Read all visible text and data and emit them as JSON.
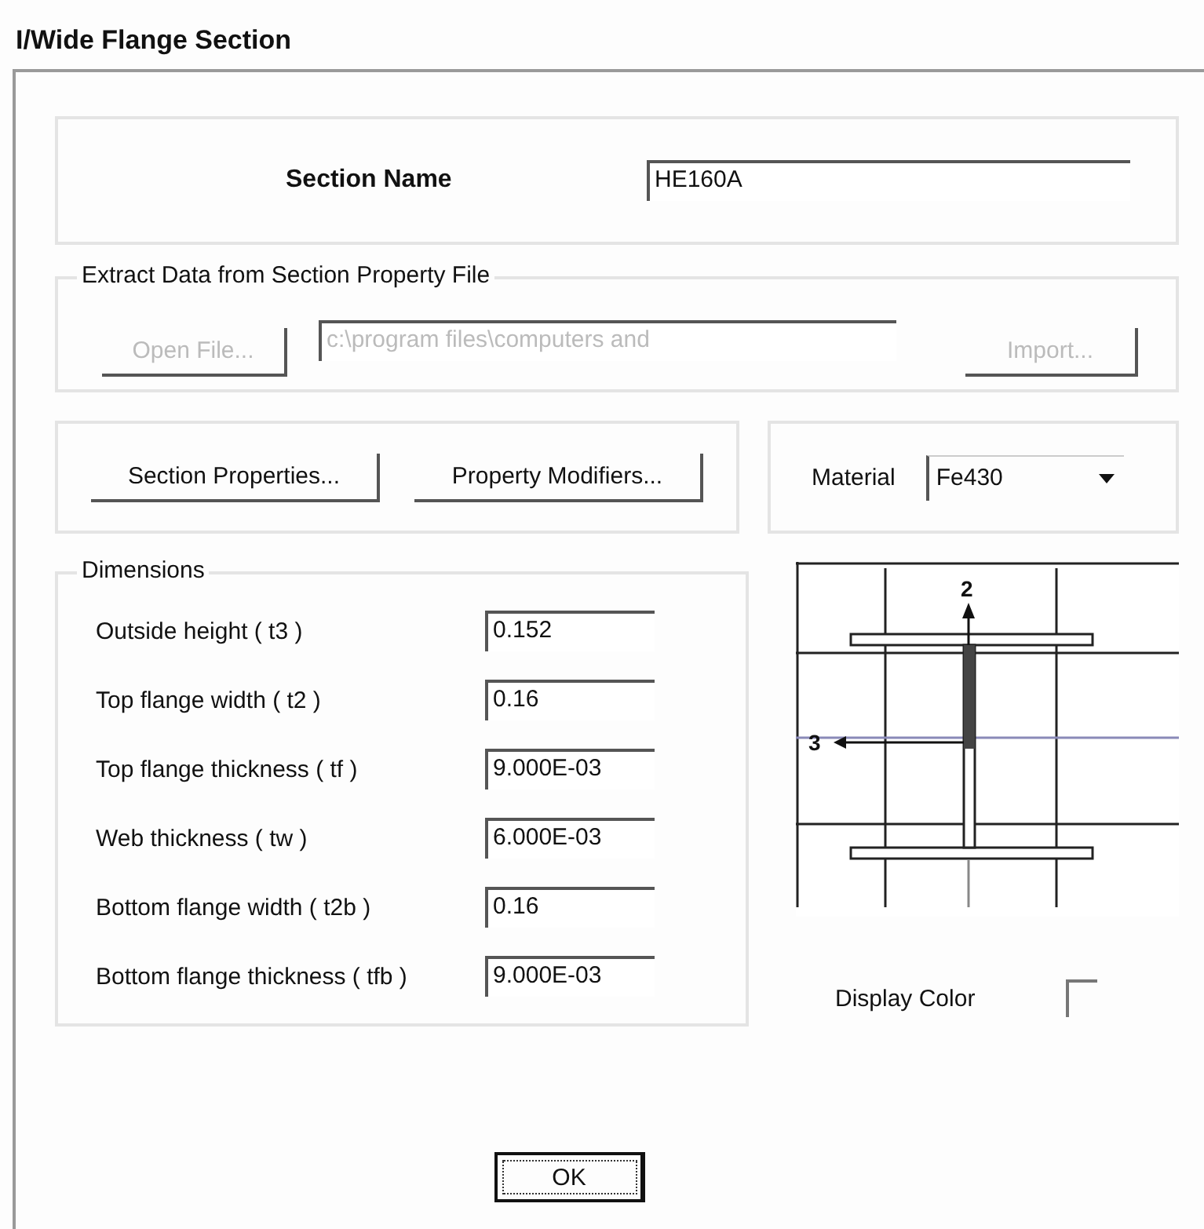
{
  "window": {
    "title": "I/Wide Flange Section"
  },
  "section_name": {
    "label": "Section Name",
    "value": "HE160A"
  },
  "extract": {
    "title": "Extract Data from Section Property File",
    "open_button": {
      "label": "Open File...",
      "disabled": true
    },
    "path": {
      "value": "c:\\program files\\computers and",
      "disabled": true
    },
    "import_button": {
      "label": "Import...",
      "disabled": true
    }
  },
  "property_buttons": [
    "Section Properties...",
    "Property Modifiers..."
  ],
  "material": {
    "label": "Material",
    "value": "Fe430"
  },
  "dimensions": {
    "title": "Dimensions",
    "rows": [
      {
        "label": "Outside height  ( t3 )",
        "value": "0.152"
      },
      {
        "label": "Top flange width  ( t2 )",
        "value": "0.16"
      },
      {
        "label": "Top flange thickness  ( tf )",
        "value": "9.000E-03"
      },
      {
        "label": "Web thickness  ( tw )",
        "value": "6.000E-03"
      },
      {
        "label": "Bottom flange width  ( t2b )",
        "value": "0.16"
      },
      {
        "label": "Bottom flange thickness  ( tfb )",
        "value": "9.000E-03"
      }
    ]
  },
  "diagram": {
    "axis_2": "2",
    "axis_3": "3"
  },
  "display_color": {
    "label": "Display Color"
  },
  "buttons": [
    "OK"
  ]
}
